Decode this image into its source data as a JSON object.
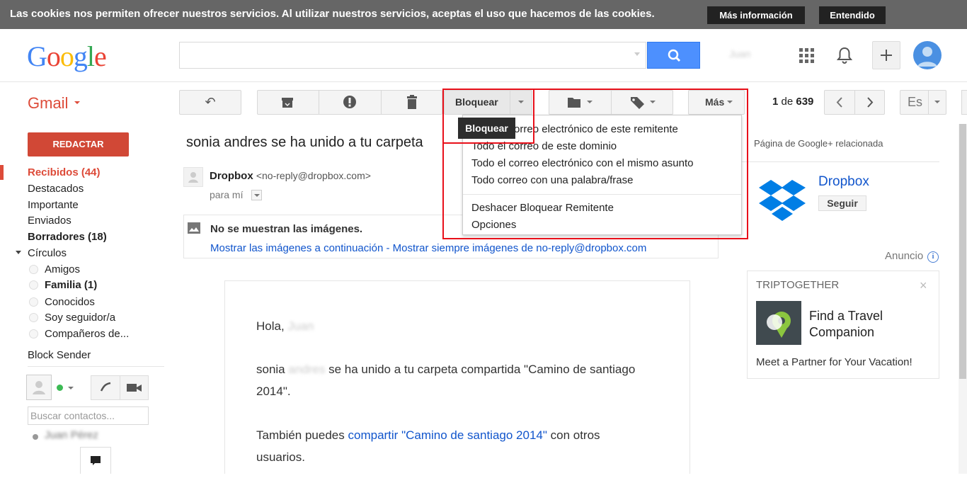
{
  "cookie_bar": {
    "message": "Las cookies nos permiten ofrecer nuestros servicios. Al utilizar nuestros servicios, aceptas el uso que hacemos de las cookies.",
    "more_info": "Más información",
    "accept": "Entendido"
  },
  "header": {
    "logo": "Google",
    "search_placeholder": "",
    "user_name": "Juan"
  },
  "toolbar": {
    "app_name": "Gmail",
    "block_label": "Bloquear",
    "more_label": "Más",
    "pagination_current": "1",
    "pagination_sep": "de",
    "pagination_total": "639",
    "lang_label": "Es"
  },
  "sidebar": {
    "compose": "REDACTAR",
    "items": [
      {
        "label": "Recibidos (44)"
      },
      {
        "label": "Destacados"
      },
      {
        "label": "Importante"
      },
      {
        "label": "Enviados"
      },
      {
        "label": "Borradores (18)"
      },
      {
        "label": "Círculos"
      }
    ],
    "circles": [
      {
        "label": "Amigos"
      },
      {
        "label": "Familia (1)"
      },
      {
        "label": "Conocidos"
      },
      {
        "label": "Soy seguidor/a"
      },
      {
        "label": "Compañeros de..."
      }
    ],
    "block_sender": "Block Sender",
    "contacts_placeholder": "Buscar contactos...",
    "contact_name": "Juan Pérez"
  },
  "message": {
    "subject": "sonia andres se ha unido a tu carpeta",
    "sender_name": "Dropbox",
    "sender_email": "<no-reply@dropbox.com>",
    "to": "para mí",
    "images_title": "No se muestran las imágenes.",
    "show_images": "Mostrar las imágenes a continuación",
    "link_sep": " - ",
    "always_show": "Mostrar siempre imágenes de no-reply@dropbox.com",
    "greeting": "Hola,",
    "greeting_name": "Juan",
    "body1_name": "sonia",
    "body1_hidden": "andres",
    "body1_rest": "se ha unido a tu carpeta compartida \"Camino de santiago",
    "body1_line2": "2014\".",
    "body2_pre": "También puedes",
    "body2_link": "compartir \"Camino de santiago 2014\"",
    "body2_post": "con otros",
    "body2_line2": "usuarios."
  },
  "block_menu": {
    "tooltip": "Bloquear",
    "items": [
      "Todo el correo electrónico de este remitente",
      "Todo el correo de este dominio",
      "Todo el correo electrónico con el mismo asunto",
      "Todo correo con una palabra/frase",
      "Deshacer Bloquear Remitente",
      "Opciones"
    ]
  },
  "right_panel": {
    "gplus_title": "Página de Google+ relacionada",
    "page_name": "Dropbox",
    "follow": "Seguir",
    "ad_label": "Anuncio",
    "ad_brand": "TRIPTOGETHER",
    "ad_title_line1": "Find a Travel",
    "ad_title_line2": "Companion",
    "ad_text": "Meet a Partner for Your Vacation!"
  },
  "colors": {
    "accent_red": "#dd4b39",
    "compose_red": "#d14836",
    "link_blue": "#1155cc",
    "search_blue": "#4d90fe",
    "highlight_red": "#e8101a"
  }
}
